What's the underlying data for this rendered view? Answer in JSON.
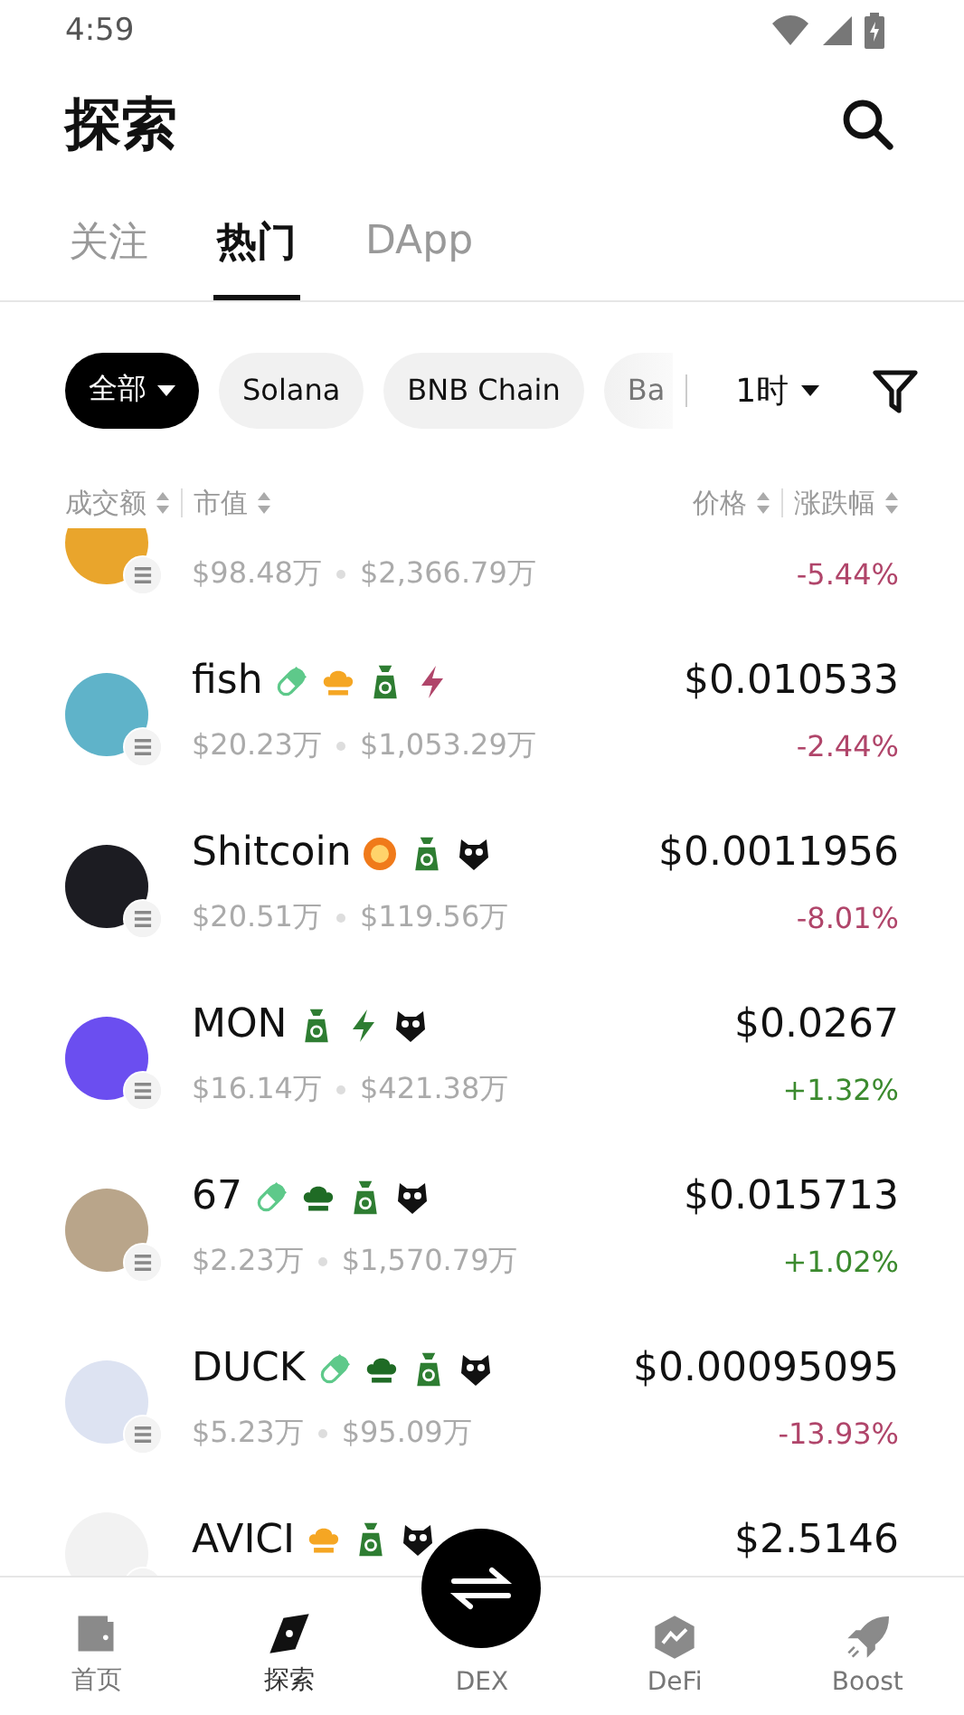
{
  "status_bar": {
    "time": "4:59"
  },
  "header": {
    "title": "探索"
  },
  "tabs": [
    {
      "label": "关注",
      "selected": false
    },
    {
      "label": "热门",
      "selected": true
    },
    {
      "label": "DApp",
      "selected": false
    }
  ],
  "chips": [
    {
      "label": "全部",
      "selected": true,
      "dropdown": true,
      "faded": false
    },
    {
      "label": "Solana",
      "selected": false,
      "dropdown": false,
      "faded": false
    },
    {
      "label": "BNB Chain",
      "selected": false,
      "dropdown": false,
      "faded": false
    },
    {
      "label": "Ba",
      "selected": false,
      "dropdown": false,
      "faded": true
    }
  ],
  "timeframe": {
    "label": "1时"
  },
  "columns": [
    "成交额",
    "市值",
    "价格",
    "涨跌幅"
  ],
  "rows": [
    {
      "color": "#e9a52c",
      "volume": "$98.48万",
      "market_cap": "$2,366.79万",
      "change": "-5.44%",
      "rising": false,
      "tags": []
    },
    {
      "color": "#5fb3c9",
      "name": "fish",
      "price": "$0.010533",
      "volume": "$20.23万",
      "market_cap": "$1,053.29万",
      "change": "-2.44%",
      "rising": false,
      "tags": [
        {
          "kind": "pill",
          "color": "#5ec98a"
        },
        {
          "kind": "hat",
          "color": "#f5a623"
        },
        {
          "kind": "bag",
          "color": "#2e7d32"
        },
        {
          "kind": "bolt",
          "color": "#b0456a"
        }
      ]
    },
    {
      "color": "#1c1c22",
      "name": "Shitcoin",
      "price": "$0.0011956",
      "volume": "$20.51万",
      "market_cap": "$119.56万",
      "change": "-8.01%",
      "rising": false,
      "tags": [
        {
          "kind": "coin",
          "color": "#f07a1a"
        },
        {
          "kind": "bag",
          "color": "#2e7d32"
        },
        {
          "kind": "owl",
          "color": "#111111"
        }
      ]
    },
    {
      "color": "#6b4ef0",
      "name": "MON",
      "price": "$0.0267",
      "volume": "$16.14万",
      "market_cap": "$421.38万",
      "change": "+1.32%",
      "rising": true,
      "tags": [
        {
          "kind": "bag",
          "color": "#2e7d32"
        },
        {
          "kind": "bolt",
          "color": "#2e7d32"
        },
        {
          "kind": "owl",
          "color": "#111111"
        }
      ]
    },
    {
      "color": "#b9a58a",
      "name": "67",
      "price": "$0.015713",
      "volume": "$2.23万",
      "market_cap": "$1,570.79万",
      "change": "+1.02%",
      "rising": true,
      "tags": [
        {
          "kind": "pill",
          "color": "#5ec98a"
        },
        {
          "kind": "hat",
          "color": "#1f6b25"
        },
        {
          "kind": "bag",
          "color": "#2e7d32"
        },
        {
          "kind": "owl",
          "color": "#111111"
        }
      ]
    },
    {
      "color": "#dde3f2",
      "name": "DUCK",
      "price": "$0.00095095",
      "volume": "$5.23万",
      "market_cap": "$95.09万",
      "change": "-13.93%",
      "rising": false,
      "tags": [
        {
          "kind": "pill",
          "color": "#5ec98a"
        },
        {
          "kind": "hat",
          "color": "#1f6b25"
        },
        {
          "kind": "bag",
          "color": "#2e7d32"
        },
        {
          "kind": "owl",
          "color": "#111111"
        }
      ]
    },
    {
      "color": "#f2f2f2",
      "name": "AVICI",
      "price": "$2.5146",
      "tags": [
        {
          "kind": "hat",
          "color": "#f5a623"
        },
        {
          "kind": "bag",
          "color": "#2e7d32"
        },
        {
          "kind": "owl",
          "color": "#111111"
        }
      ]
    }
  ],
  "nav": [
    {
      "label": "首页",
      "kind": "wallet",
      "selected": false
    },
    {
      "label": "探索",
      "kind": "compass",
      "selected": true
    },
    {
      "label": "DEX",
      "kind": "swap",
      "selected": false
    },
    {
      "label": "DeFi",
      "kind": "defi",
      "selected": false
    },
    {
      "label": "Boost",
      "kind": "rocket",
      "selected": false
    }
  ]
}
